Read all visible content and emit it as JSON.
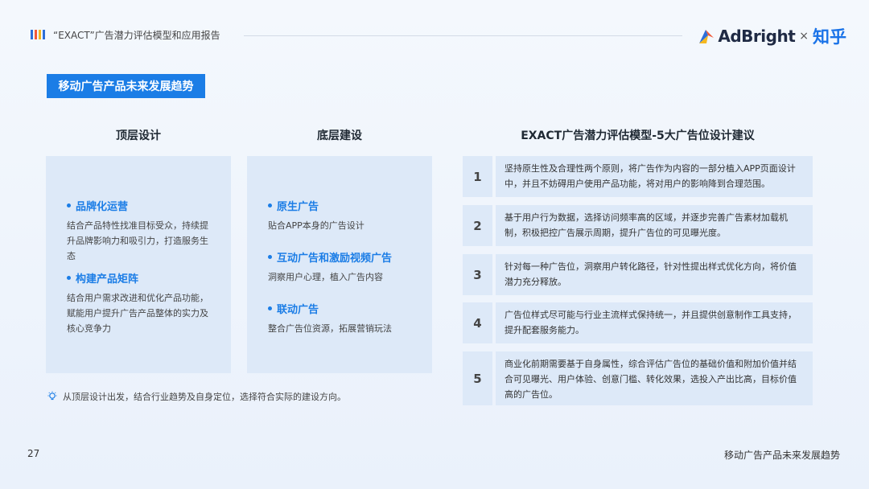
{
  "header": {
    "title": "“EXACT”广告潜力评估模型和应用报告",
    "logo_bar_colors": [
      "#2e6fd8",
      "#f25a3a",
      "#f5b820",
      "#2e6fd8"
    ],
    "brand_name": "AdBright",
    "brand_times": "×",
    "brand_partner": "知乎"
  },
  "section_tag": "移动广告产品未来发展趋势",
  "columns": {
    "top": {
      "title": "顶层设计",
      "items": [
        {
          "title": "品牌化运营",
          "desc": "结合产品特性找准目标受众，持续提升品牌影响力和吸引力，打造服务生态"
        },
        {
          "title": "构建产品矩阵",
          "desc": "结合用户需求改进和优化产品功能，赋能用户提升广告产品整体的实力及核心竞争力"
        }
      ]
    },
    "base": {
      "title": "底层建设",
      "items": [
        {
          "title": "原生广告",
          "desc": "贴合APP本身的广告设计"
        },
        {
          "title": "互动广告和激励视频广告",
          "desc": "洞察用户心理，植入广告内容"
        },
        {
          "title": "联动广告",
          "desc": "整合广告位资源，拓展营销玩法"
        }
      ]
    },
    "exact": {
      "title": "EXACT广告潜力评估模型-5大广告位设计建议",
      "rows": [
        {
          "num": "1",
          "text": "坚持原生性及合理性两个原则，将广告作为内容的一部分植入APP页面设计中，并且不妨碍用户使用产品功能，将对用户的影响降到合理范围。"
        },
        {
          "num": "2",
          "text": "基于用户行为数据，选择访问频率高的区域，并逐步完善广告素材加载机制，积极把控广告展示周期，提升广告位的可见曝光度。"
        },
        {
          "num": "3",
          "text": "针对每一种广告位，洞察用户转化路径，针对性提出样式优化方向，将价值潜力充分释放。"
        },
        {
          "num": "4",
          "text": "广告位样式尽可能与行业主流样式保持统一，并且提供创意制作工具支持，提升配套服务能力。"
        },
        {
          "num": "5",
          "text": "商业化前期需要基于自身属性，综合评估广告位的基础价值和附加价值并结合可见曝光、用户体验、创意门槛、转化效果，选投入产出比高，目标价值高的广告位。"
        }
      ]
    }
  },
  "tip": "从顶层设计出发，结合行业趋势及自身定位，选择符合实际的建设方向。",
  "footer": {
    "page_number": "27",
    "title": "移动广告产品未来发展趋势"
  },
  "colors": {
    "accent": "#1b7de6",
    "panel": "#dde9f8",
    "zhihu_blue": "#1a73e8"
  }
}
